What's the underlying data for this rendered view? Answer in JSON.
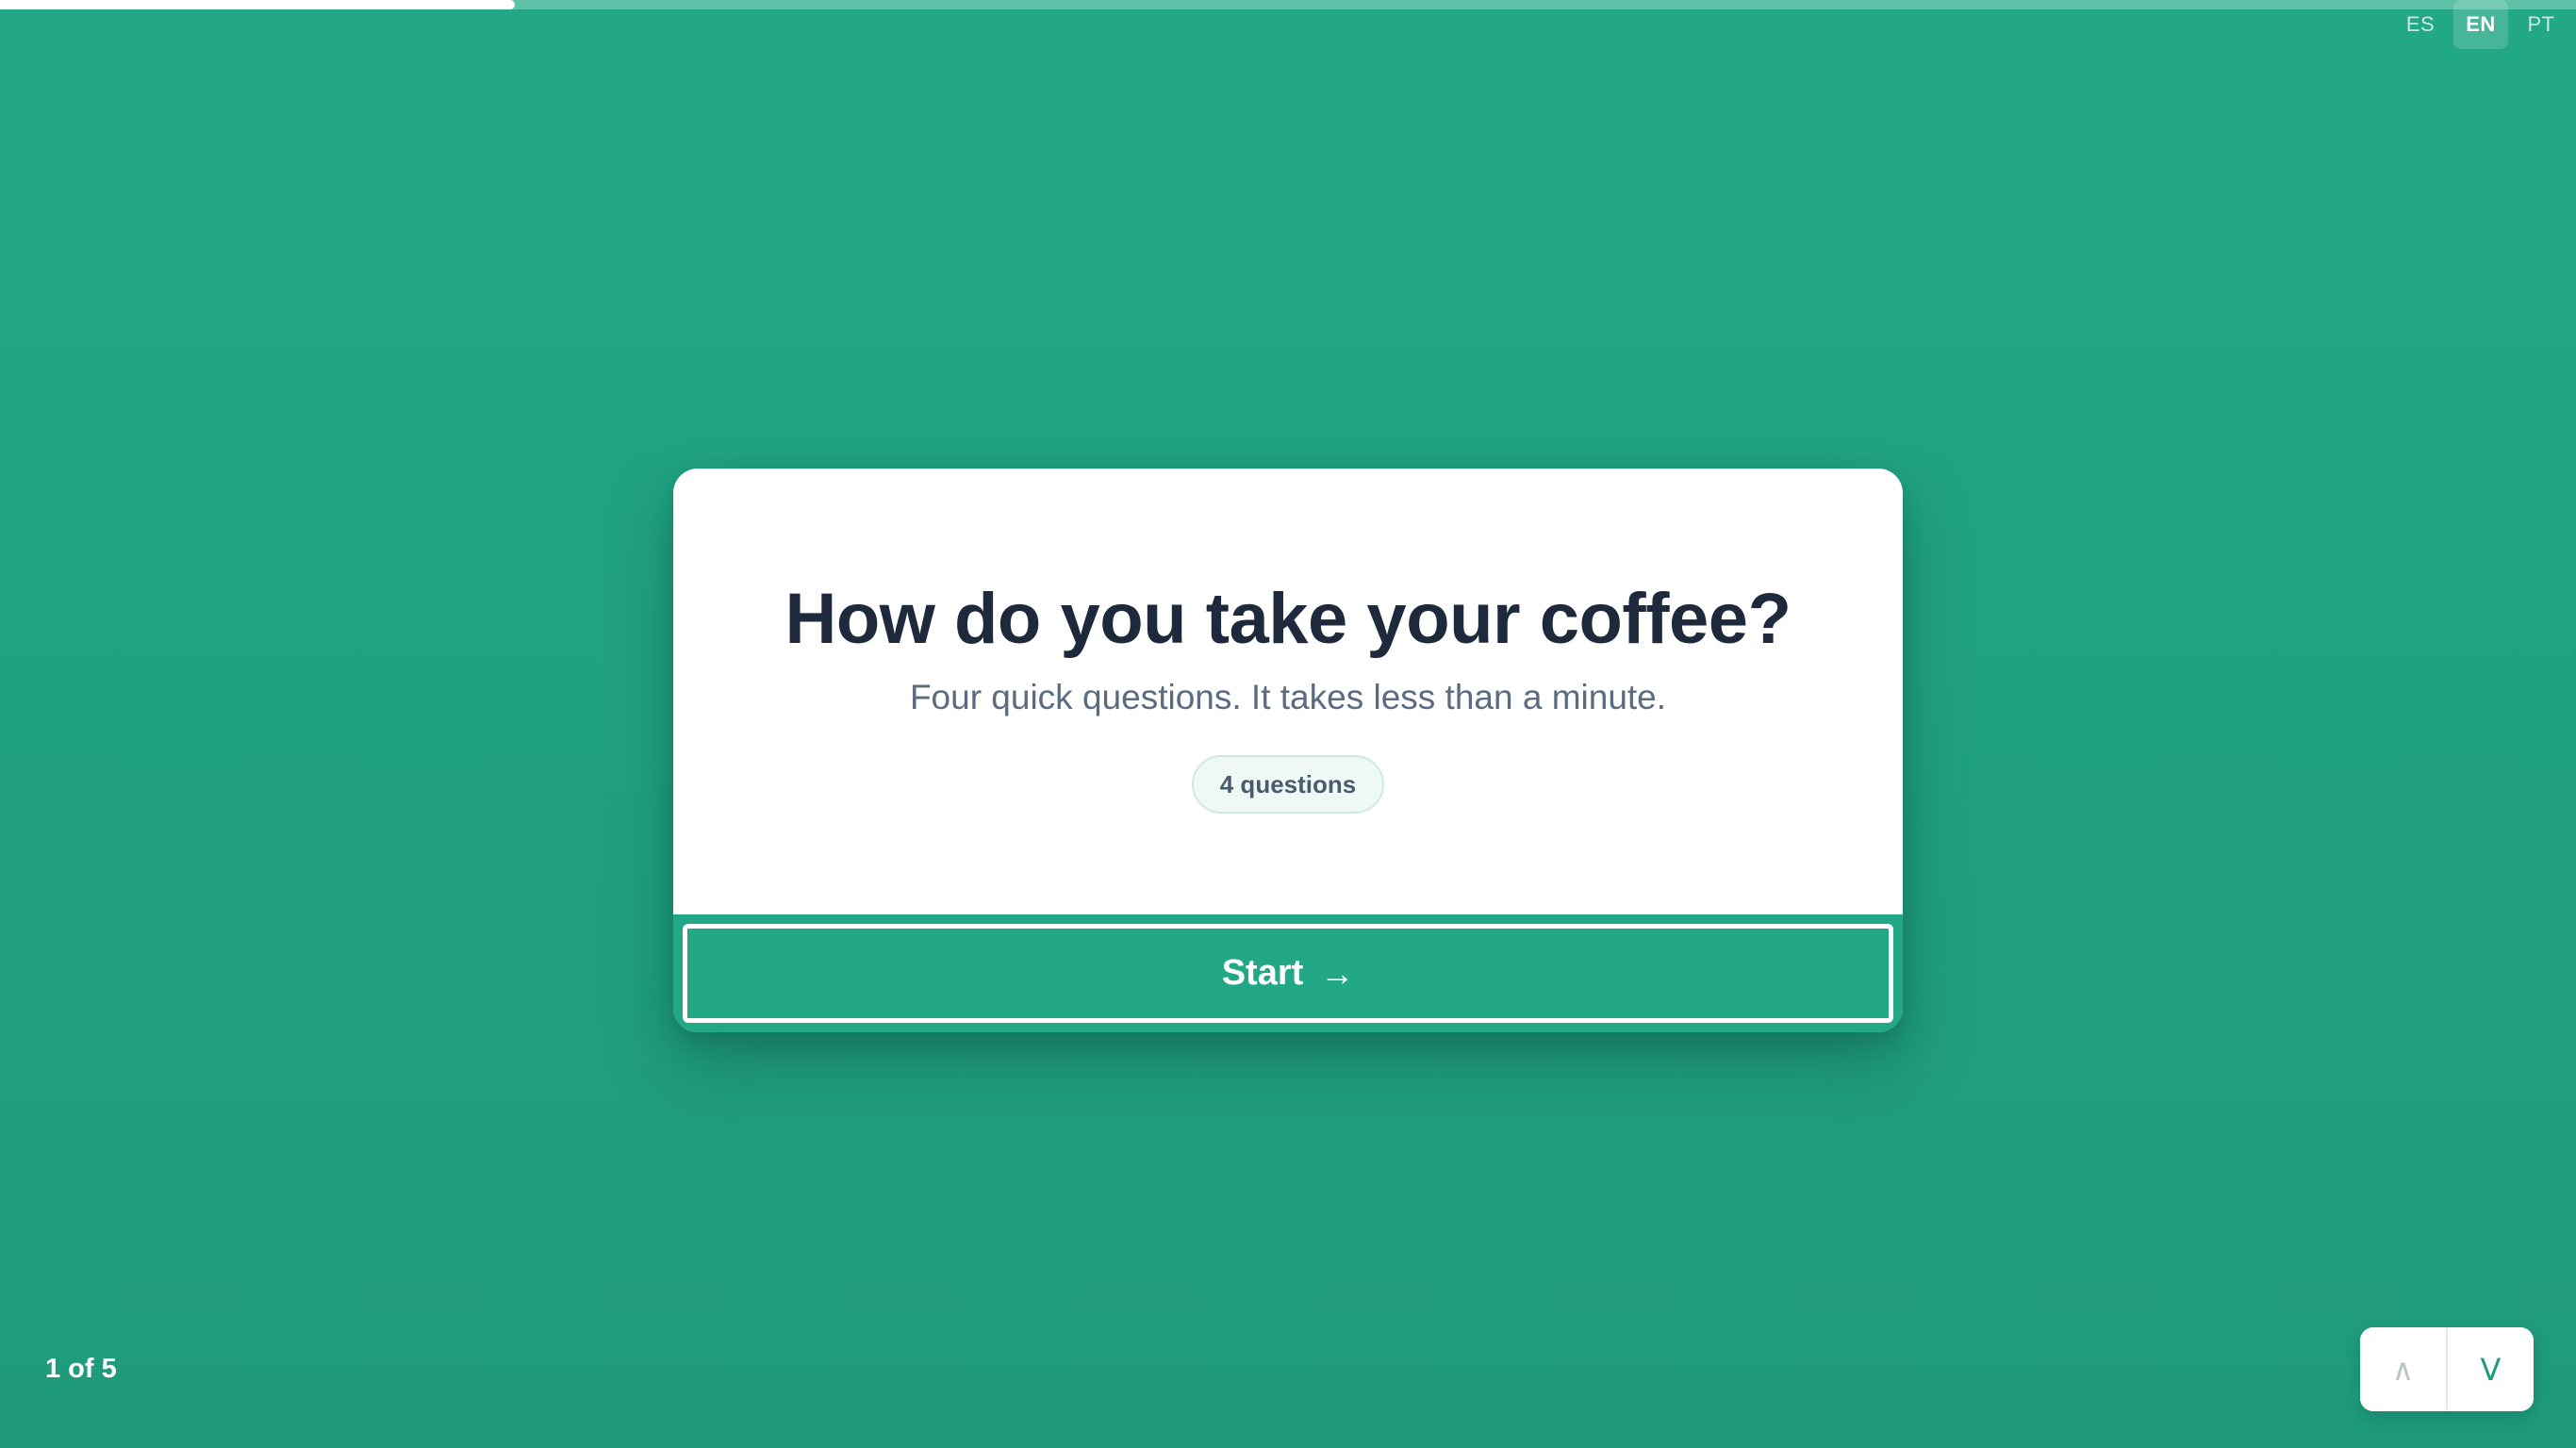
{
  "progress": {
    "fraction": 0.2
  },
  "languages": [
    {
      "code": "ES",
      "active": false
    },
    {
      "code": "EN",
      "active": true
    },
    {
      "code": "PT",
      "active": false
    }
  ],
  "card": {
    "title": "How do you take your coffee?",
    "subtitle": "Four quick questions. It takes less than a minute.",
    "badge": "4 questions",
    "start_label": "Start",
    "start_icon": "→"
  },
  "footer": {
    "page_counter": "1 of 5",
    "prev_icon": "∧",
    "next_icon": "V"
  },
  "colors": {
    "background": "#22a887",
    "card": "#ffffff",
    "title": "#1e293b",
    "subtitle": "#5b6b80"
  }
}
